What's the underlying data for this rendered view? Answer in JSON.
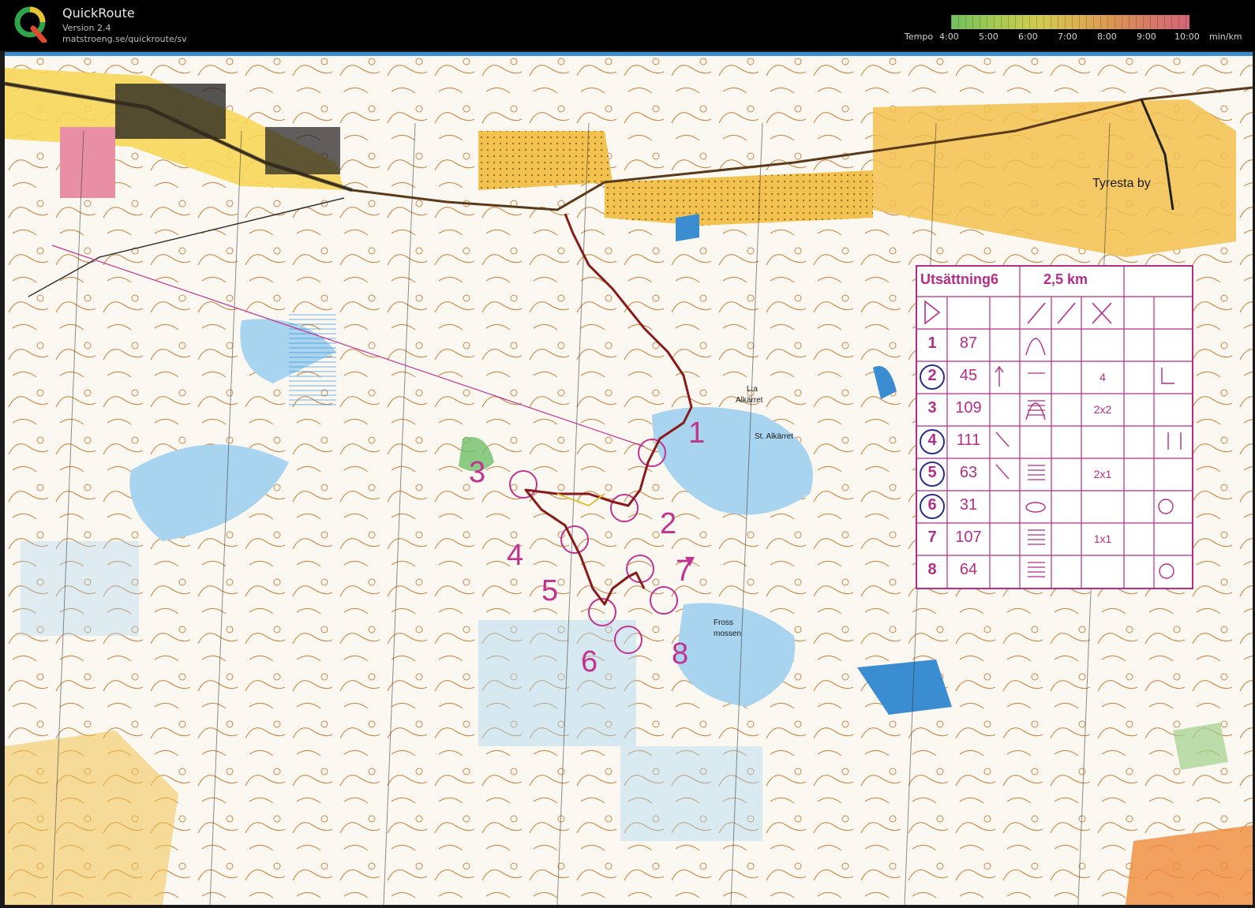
{
  "app": {
    "name": "QuickRoute",
    "version": "Version 2.4",
    "url": "matstroeng.se/quickroute/sv"
  },
  "tempo": {
    "label": "Tempo",
    "ticks": [
      "4:00",
      "5:00",
      "6:00",
      "7:00",
      "8:00",
      "9:00",
      "10:00"
    ],
    "unit": "min/km"
  },
  "map": {
    "place_labels": [
      "Tyresta by",
      "L:a",
      "Alkärret",
      "St. Alkärret",
      "Fross",
      "mossen"
    ],
    "controls": [
      "3",
      "4",
      "5",
      "2",
      "7",
      "6",
      "8",
      "1"
    ]
  },
  "description": {
    "title": "Utsättning6",
    "length": "2,5 km",
    "rows": [
      {
        "num": "1",
        "code": "87",
        "dim": ""
      },
      {
        "num": "2",
        "code": "45",
        "dim": "4"
      },
      {
        "num": "3",
        "code": "109",
        "dim": "2x2"
      },
      {
        "num": "4",
        "code": "111",
        "dim": ""
      },
      {
        "num": "5",
        "code": "63",
        "dim": "2x1"
      },
      {
        "num": "6",
        "code": "31",
        "dim": ""
      },
      {
        "num": "7",
        "code": "107",
        "dim": "1x1"
      },
      {
        "num": "8",
        "code": "64",
        "dim": ""
      }
    ]
  },
  "colors": {
    "course": "#c2328f",
    "route": "#8a1a1a",
    "contour": "#c98a4a",
    "water": "#a8d4ef",
    "yellow": "#f2c14e"
  }
}
